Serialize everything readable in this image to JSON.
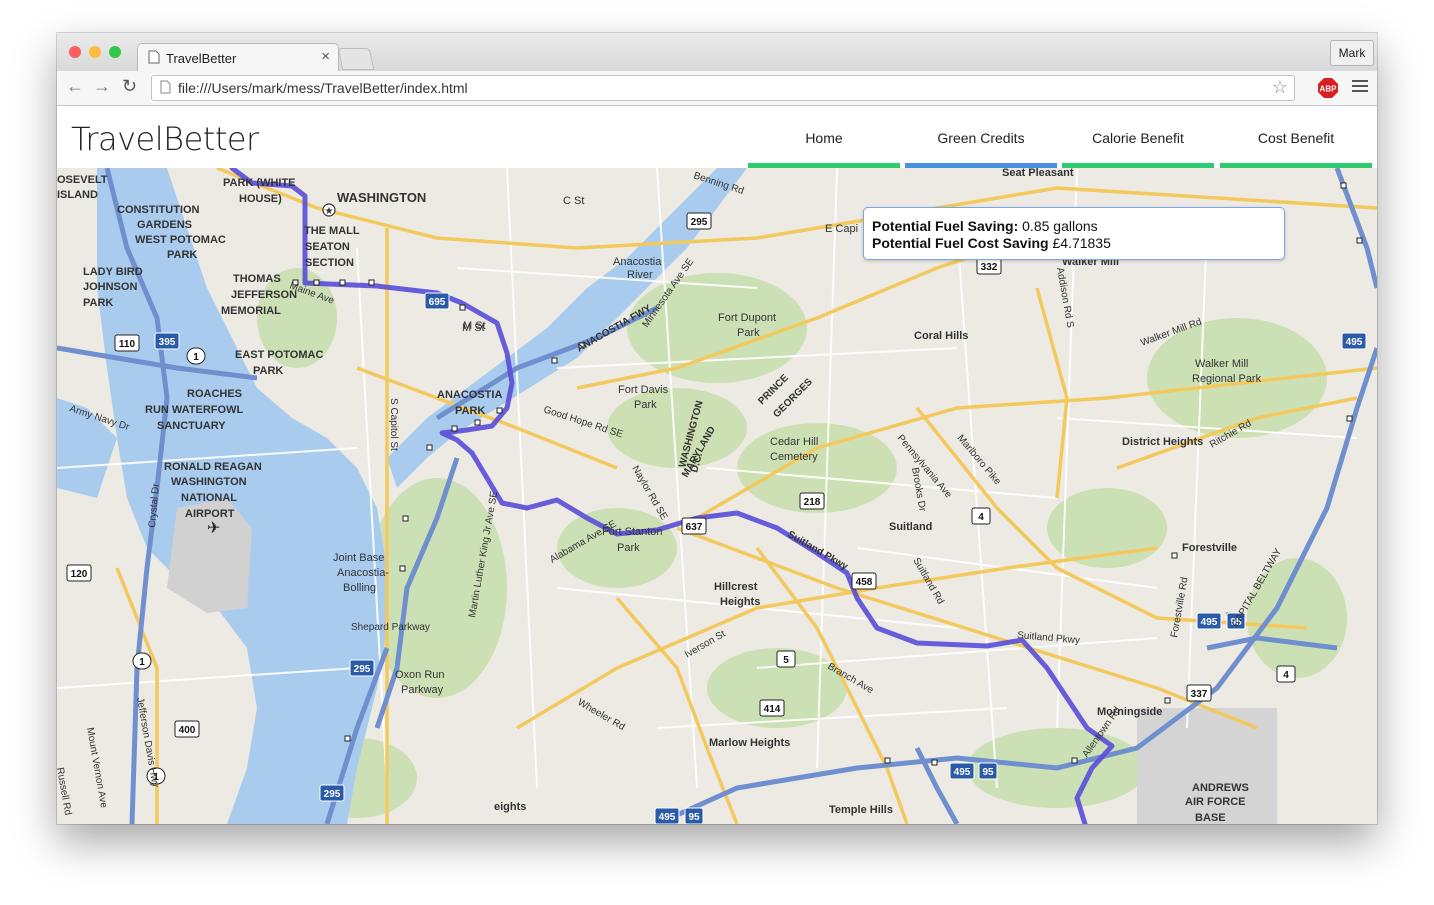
{
  "browser": {
    "tab_title": "TravelBetter",
    "url": "file:///Users/mark/mess/TravelBetter/index.html",
    "profile_name": "Mark",
    "extension_label": "ABP",
    "colors": {
      "close": "#fc605c",
      "minimize": "#fdbc40",
      "zoom": "#34c84a"
    }
  },
  "app": {
    "brand": "TravelBetter",
    "nav": [
      {
        "label": "Home",
        "indicator_color": "#2ecc71"
      },
      {
        "label": "Green Credits",
        "indicator_color": "#4a90e2"
      },
      {
        "label": "Calorie Benefit",
        "indicator_color": "#2ecc71"
      },
      {
        "label": "Cost Benefit",
        "indicator_color": "#2ecc71"
      }
    ]
  },
  "popup": {
    "fuel_saving_label": "Potential Fuel Saving:",
    "fuel_saving_value": "0.85 gallons",
    "cost_saving_label": "Potential Fuel Cost Saving",
    "cost_saving_value": "£4.71835"
  },
  "map": {
    "route_color": "#5b4fd8",
    "place_labels": [
      "WASHINGTON",
      "THE MALL",
      "SEATON",
      "SECTION",
      "C St",
      "E Capi",
      "Benning Rd",
      "Seat Pleasant",
      "Walker Mill",
      "Anacostia",
      "River",
      "Fort Dupont",
      "Park",
      "Coral Hills",
      "Walker Mill Rd",
      "Walker Mill",
      "Regional Park",
      "M St",
      "ANACOSTIA FWY",
      "Minnesota Ave SE",
      "Good Hope Rd SE",
      "Fort Davis",
      "Park",
      "ANACOSTIA",
      "PARK",
      "EAST POTOMAC",
      "PARK",
      "THOMAS",
      "JEFFERSON",
      "MEMORIAL",
      "LADY BIRD",
      "JOHNSON",
      "PARK",
      "CONSTITUTION",
      "GARDENS",
      "WEST POTOMAC",
      "PARK",
      "OSEVELT",
      "ISLAND",
      "PARK (WHITE",
      "HOUSE)",
      "ROACHES",
      "RUN WATERFOWL",
      "SANCTUARY",
      "Army Navy Dr",
      "RONALD REAGAN",
      "WASHINGTON",
      "NATIONAL",
      "AIRPORT",
      "Jefferson Davis Hwy",
      "Crystal Dr",
      "Joint Base",
      "Anacostia-",
      "Bolling",
      "Shepard Parkway",
      "Oxon Run",
      "Parkway",
      "S Capitol St",
      "Martin Luther King Jr Ave SE",
      "Alabama Ave SE",
      "Fort Stanton",
      "Park",
      "Naylor Rd SE",
      "Suitland Pkwy",
      "Hillcrest",
      "Heights",
      "Iverson St",
      "Branch Ave",
      "Wheeler Rd",
      "Marlow Heights",
      "Temple Hills",
      "Suitland",
      "Suitland Rd",
      "Forestville",
      "CAPITAL BELTWAY",
      "Forestville Rd",
      "District Heights",
      "Marlboro Pike",
      "Pennsylvania Ave",
      "Brooks Dr",
      "Addison Rd S",
      "Ritchie Rd",
      "Cedar Hill",
      "Cemetery",
      "PRINCE",
      "GEORGES",
      "WASHINGTON",
      "D.C.",
      "MARYLAND",
      "Morningside",
      "Allentown Rd",
      "ANDREWS",
      "AIR FORCE",
      "BASE",
      "Mount Vernon Ave",
      "Russell Rd",
      "eights",
      "Maine Ave",
      "M St",
      "Suitland Pkwy"
    ],
    "shields": [
      "295",
      "395",
      "1",
      "110",
      "120",
      "1",
      "400",
      "1",
      "295",
      "295",
      "695",
      "332",
      "218",
      "4",
      "637",
      "458",
      "5",
      "414",
      "495",
      "95",
      "337",
      "4",
      "495",
      "95",
      "495",
      "95",
      "495"
    ]
  }
}
